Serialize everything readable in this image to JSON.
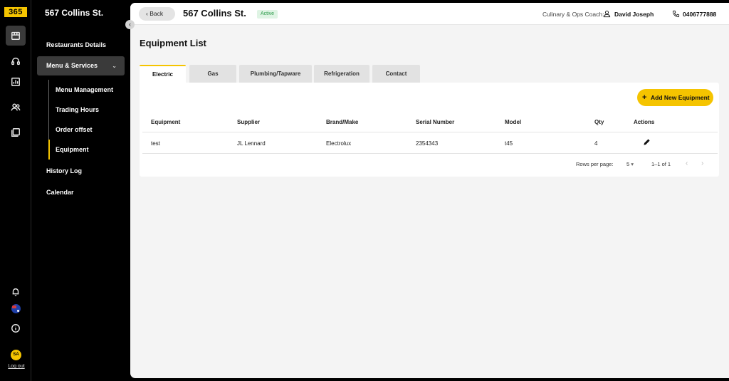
{
  "rail": {
    "logo": "365",
    "avatar_initials": "SA",
    "logout_label": "Log out"
  },
  "sidebar": {
    "title": "567 Collins St.",
    "items": [
      {
        "label": "Restaurants Details"
      },
      {
        "label": "Menu & Services"
      },
      {
        "label": "History Log"
      },
      {
        "label": "Calendar"
      }
    ],
    "sub_items": [
      {
        "label": "Menu Management"
      },
      {
        "label": "Trading Hours"
      },
      {
        "label": "Order offset"
      },
      {
        "label": "Equipment"
      }
    ]
  },
  "topbar": {
    "back_label": "Back",
    "title": "567 Collins St.",
    "status": "Active",
    "coach_label": "Culinary & Ops Coach:",
    "coach_name": "David Joseph",
    "phone": "0406777888"
  },
  "section_title": "Equipment List",
  "tabs": [
    {
      "label": "Electric"
    },
    {
      "label": "Gas"
    },
    {
      "label": "Plumbing/Tapware"
    },
    {
      "label": "Refrigeration"
    },
    {
      "label": "Contact"
    }
  ],
  "add_button_label": "Add New Equipment",
  "table": {
    "headers": [
      "Equipment",
      "Supplier",
      "Brand/Make",
      "Serial Number",
      "Model",
      "Qty",
      "Actions"
    ],
    "rows": [
      [
        "test",
        "JL Lennard",
        "Electrolux",
        "2354343",
        "t45",
        "4"
      ]
    ]
  },
  "pagination": {
    "rows_per_page_label": "Rows per page:",
    "rows_per_page_value": "5",
    "range": "1–1 of 1"
  },
  "colors": {
    "accent": "#f5c400",
    "sidebar_bg": "#000000",
    "active_badge_bg": "#dff4e4",
    "active_badge_text": "#2c9a4a"
  }
}
